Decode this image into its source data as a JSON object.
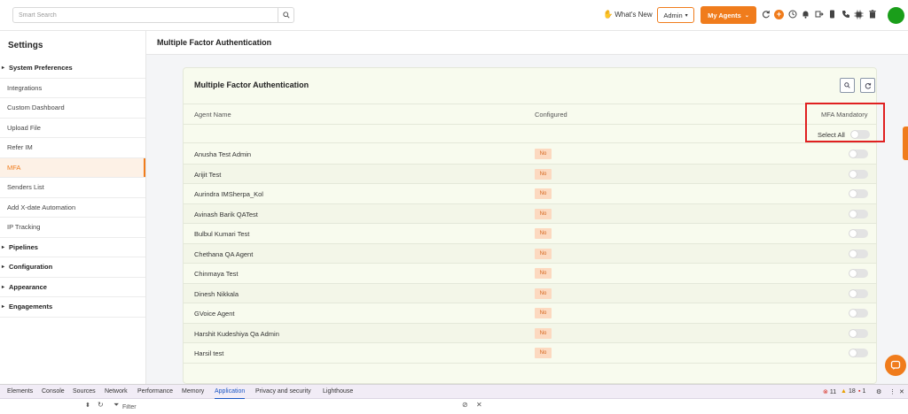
{
  "topbar": {
    "search_placeholder": "Smart Search",
    "whats_new": "What's New",
    "role": "Admin",
    "my_agents": "My Agents",
    "accent_color": "#f07c1c"
  },
  "sidebar": {
    "title": "Settings",
    "items": [
      {
        "label": "System Preferences",
        "group": true
      },
      {
        "label": "Integrations"
      },
      {
        "label": "Custom Dashboard"
      },
      {
        "label": "Upload File"
      },
      {
        "label": "Refer IM"
      },
      {
        "label": "MFA",
        "active": true
      },
      {
        "label": "Senders List"
      },
      {
        "label": "Add X-date Automation"
      },
      {
        "label": "IP Tracking"
      },
      {
        "label": "Pipelines",
        "group": true
      },
      {
        "label": "Configuration",
        "group": true
      },
      {
        "label": "Appearance",
        "group": true
      },
      {
        "label": "Engagements",
        "group": true
      }
    ]
  },
  "main": {
    "page_title": "Multiple Factor Authentication",
    "card_title": "Multiple Factor Authentication",
    "columns": {
      "agent_name": "Agent Name",
      "configured": "Configured",
      "mfa_mandatory": "MFA Mandatory"
    },
    "select_all": "Select All",
    "rows": [
      {
        "name": "Anusha Test Admin",
        "configured": "No"
      },
      {
        "name": "Arijit Test",
        "configured": "No"
      },
      {
        "name": "Aurindra IMSherpa_Kol",
        "configured": "No"
      },
      {
        "name": "Avinash Barik QATest",
        "configured": "No"
      },
      {
        "name": "Bulbul Kumari Test",
        "configured": "No"
      },
      {
        "name": "Chethana QA Agent",
        "configured": "No"
      },
      {
        "name": "Chinmaya Test",
        "configured": "No"
      },
      {
        "name": "Dinesh Nikkala",
        "configured": "No"
      },
      {
        "name": "GVoice Agent",
        "configured": "No"
      },
      {
        "name": "Harshit Kudeshiya Qa Admin",
        "configured": "No"
      },
      {
        "name": "Harsil test",
        "configured": "No"
      }
    ]
  },
  "devtools": {
    "tabs": [
      "Elements",
      "Console",
      "Sources",
      "Network",
      "Performance",
      "Memory",
      "Application",
      "Privacy and security",
      "Lighthouse"
    ],
    "active_tab": "Application",
    "errors": "11",
    "warnings": "18",
    "issues": "1",
    "filter_placeholder": "Filter"
  }
}
